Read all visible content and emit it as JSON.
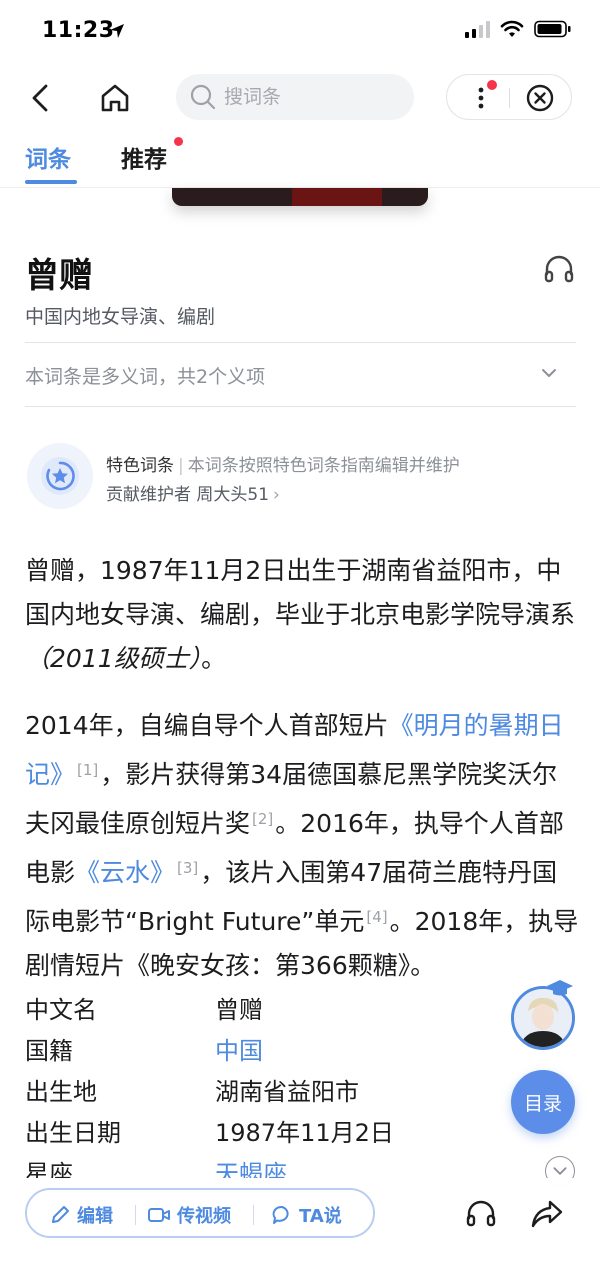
{
  "status_bar": {
    "time": "11:23"
  },
  "nav": {
    "search_placeholder": "搜词条"
  },
  "tabs": [
    {
      "label": "词条",
      "active": true
    },
    {
      "label": "推荐",
      "active": false,
      "has_badge_dot": true
    }
  ],
  "entry": {
    "title": "曾赠",
    "subtitle": "中国内地女导演、编剧",
    "polysemy_note": "本词条是多义词，共2个义项"
  },
  "featured": {
    "label": "特色词条",
    "description": "本词条按照特色词条指南编辑并维护",
    "maintainer_label": "贡献维护者 周大头51",
    "chevron": "›"
  },
  "paragraph1": {
    "text_a": "曾赠，1987年11月2日出生于湖南省益阳市，中国内地女导演、编剧，毕业于北京电影学院导演系",
    "text_italic": "（2011级硕士）",
    "text_end": "。"
  },
  "paragraph2": {
    "t1": "2014年，自编自导个人首部短片",
    "link1": "《明月的暑期日记》",
    "ref1": "[1]",
    "t2": "，影片获得第34届德国慕尼黑学院奖沃尔夫冈最佳原创短片奖",
    "ref2": "[2]",
    "t3": "。2016年，执导个人首部电影",
    "link2": "《云水》",
    "ref3": "[3]",
    "t4": "，该片入围第47届荷兰鹿特丹国际电影节“Bright Future”单元",
    "ref4": "[4]",
    "t5": "。2018年，执导剧情短片《晚安女孩：第366颗糖》。"
  },
  "info": [
    {
      "key": "中文名",
      "value": "曾赠",
      "link": false
    },
    {
      "key": "国籍",
      "value": "中国",
      "link": true
    },
    {
      "key": "出生地",
      "value": "湖南省益阳市",
      "link": false
    },
    {
      "key": "出生日期",
      "value": "1987年11月2日",
      "link": false
    },
    {
      "key": "星座",
      "value": "天蝎座",
      "link": true
    }
  ],
  "floating": {
    "toc_label": "目录"
  },
  "bottom": {
    "edit_label": "编辑",
    "video_label": "传视频",
    "ta_label": "TA说"
  },
  "colors": {
    "accent": "#4e8ae0",
    "badge_red": "#f5334b",
    "text": "#1d1d1f",
    "muted": "#8c9097"
  }
}
